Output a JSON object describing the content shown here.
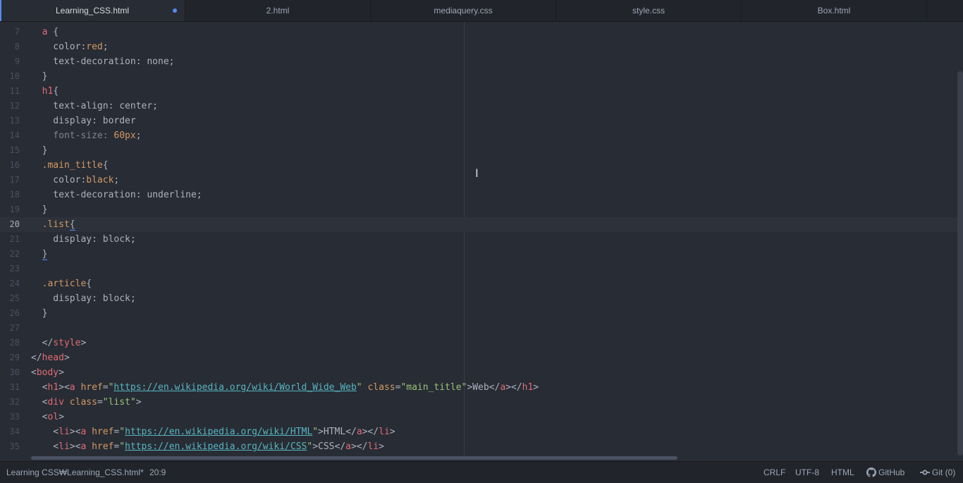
{
  "tabs": [
    {
      "label": "Learning_CSS.html",
      "modified": true
    },
    {
      "label": "2.html"
    },
    {
      "label": "mediaquery.css"
    },
    {
      "label": "style.css"
    },
    {
      "label": "Box.html"
    }
  ],
  "editor": {
    "lines": [
      {
        "n": "7",
        "segs": [
          [
            "t-punc",
            "  "
          ],
          [
            "t-tag",
            "a"
          ],
          [
            "t-punc",
            " {"
          ]
        ]
      },
      {
        "n": "8",
        "segs": [
          [
            "t-prop",
            "    color:"
          ],
          [
            "t-sel",
            "red"
          ],
          [
            "t-punc",
            ";"
          ]
        ]
      },
      {
        "n": "9",
        "segs": [
          [
            "t-prop",
            "    text-decoration: none;"
          ]
        ]
      },
      {
        "n": "10",
        "segs": [
          [
            "t-punc",
            "  }"
          ]
        ]
      },
      {
        "n": "11",
        "segs": [
          [
            "t-punc",
            "  "
          ],
          [
            "t-tag",
            "h1"
          ],
          [
            "t-punc",
            "{"
          ]
        ]
      },
      {
        "n": "12",
        "segs": [
          [
            "t-prop",
            "    text-align: center;"
          ]
        ]
      },
      {
        "n": "13",
        "segs": [
          [
            "t-prop",
            "    display: border"
          ]
        ]
      },
      {
        "n": "14",
        "segs": [
          [
            "t-dim",
            "    font-size: "
          ],
          [
            "t-num",
            "60px"
          ],
          [
            "t-punc",
            ";"
          ]
        ]
      },
      {
        "n": "15",
        "segs": [
          [
            "t-punc",
            "  }"
          ]
        ]
      },
      {
        "n": "16",
        "segs": [
          [
            "t-punc",
            "  "
          ],
          [
            "t-sel",
            ".main_title"
          ],
          [
            "t-punc",
            "{"
          ]
        ]
      },
      {
        "n": "17",
        "segs": [
          [
            "t-prop",
            "    color:"
          ],
          [
            "t-sel",
            "black"
          ],
          [
            "t-punc",
            ";"
          ]
        ]
      },
      {
        "n": "18",
        "segs": [
          [
            "t-prop",
            "    text-decoration: underline;"
          ]
        ]
      },
      {
        "n": "19",
        "segs": [
          [
            "t-punc",
            "  }"
          ]
        ]
      },
      {
        "n": "20",
        "cursor": true,
        "segs": [
          [
            "t-punc",
            "  "
          ],
          [
            "t-sel",
            ".list"
          ],
          [
            "t-bracket",
            "{"
          ]
        ]
      },
      {
        "n": "21",
        "segs": [
          [
            "t-prop",
            "    display: block;"
          ]
        ]
      },
      {
        "n": "22",
        "segs": [
          [
            "t-punc",
            "  "
          ],
          [
            "t-bracket",
            "}"
          ]
        ]
      },
      {
        "n": "23",
        "segs": []
      },
      {
        "n": "24",
        "segs": [
          [
            "t-punc",
            "  "
          ],
          [
            "t-sel",
            ".article"
          ],
          [
            "t-punc",
            "{"
          ]
        ]
      },
      {
        "n": "25",
        "segs": [
          [
            "t-prop",
            "    display: block;"
          ]
        ]
      },
      {
        "n": "26",
        "segs": [
          [
            "t-punc",
            "  }"
          ]
        ]
      },
      {
        "n": "27",
        "segs": []
      },
      {
        "n": "28",
        "segs": [
          [
            "t-punc",
            "  </"
          ],
          [
            "t-tag",
            "style"
          ],
          [
            "t-punc",
            ">"
          ]
        ]
      },
      {
        "n": "29",
        "segs": [
          [
            "t-punc",
            "</"
          ],
          [
            "t-tag",
            "head"
          ],
          [
            "t-punc",
            ">"
          ]
        ]
      },
      {
        "n": "30",
        "segs": [
          [
            "t-punc",
            "<"
          ],
          [
            "t-tag",
            "body"
          ],
          [
            "t-punc",
            ">"
          ]
        ]
      },
      {
        "n": "31",
        "segs": [
          [
            "t-punc",
            "  <"
          ],
          [
            "t-tag",
            "h1"
          ],
          [
            "t-punc",
            "><"
          ],
          [
            "t-tag",
            "a"
          ],
          [
            "t-attr",
            " href"
          ],
          [
            "t-punc",
            "="
          ],
          [
            "t-str",
            "\""
          ],
          [
            "t-url",
            "https://en.wikipedia.org/wiki/World_Wide_Web"
          ],
          [
            "t-str",
            "\""
          ],
          [
            "t-attr",
            " class"
          ],
          [
            "t-punc",
            "="
          ],
          [
            "t-str",
            "\"main_title\""
          ],
          [
            "t-punc",
            ">Web</"
          ],
          [
            "t-tag",
            "a"
          ],
          [
            "t-punc",
            "></"
          ],
          [
            "t-tag",
            "h1"
          ],
          [
            "t-punc",
            ">"
          ]
        ]
      },
      {
        "n": "32",
        "segs": [
          [
            "t-punc",
            "  <"
          ],
          [
            "t-tag",
            "div"
          ],
          [
            "t-attr",
            " class"
          ],
          [
            "t-punc",
            "="
          ],
          [
            "t-str",
            "\"list\""
          ],
          [
            "t-punc",
            ">"
          ]
        ]
      },
      {
        "n": "33",
        "segs": [
          [
            "t-punc",
            "  <"
          ],
          [
            "t-tag",
            "ol"
          ],
          [
            "t-punc",
            ">"
          ]
        ]
      },
      {
        "n": "34",
        "segs": [
          [
            "t-punc",
            "    <"
          ],
          [
            "t-tag",
            "li"
          ],
          [
            "t-punc",
            "><"
          ],
          [
            "t-tag",
            "a"
          ],
          [
            "t-attr",
            " href"
          ],
          [
            "t-punc",
            "="
          ],
          [
            "t-str",
            "\""
          ],
          [
            "t-url",
            "https://en.wikipedia.org/wiki/HTML"
          ],
          [
            "t-str",
            "\""
          ],
          [
            "t-punc",
            ">HTML</"
          ],
          [
            "t-tag",
            "a"
          ],
          [
            "t-punc",
            "></"
          ],
          [
            "t-tag",
            "li"
          ],
          [
            "t-punc",
            ">"
          ]
        ]
      },
      {
        "n": "35",
        "segs": [
          [
            "t-punc",
            "    <"
          ],
          [
            "t-tag",
            "li"
          ],
          [
            "t-punc",
            "><"
          ],
          [
            "t-tag",
            "a"
          ],
          [
            "t-attr",
            " href"
          ],
          [
            "t-punc",
            "="
          ],
          [
            "t-str",
            "\""
          ],
          [
            "t-url",
            "https://en.wikipedia.org/wiki/CSS"
          ],
          [
            "t-str",
            "\""
          ],
          [
            "t-punc",
            ">CSS</"
          ],
          [
            "t-tag",
            "a"
          ],
          [
            "t-punc",
            "></"
          ],
          [
            "t-tag",
            "li"
          ],
          [
            "t-punc",
            ">"
          ]
        ]
      }
    ]
  },
  "status": {
    "file_path": "Learning CSS₩Learning_CSS.html*",
    "cursor_pos": "20:9",
    "line_ending": "CRLF",
    "encoding": "UTF-8",
    "grammar": "HTML",
    "github_label": "GitHub",
    "git_label": "Git (0)"
  },
  "icons": {
    "github": "github-icon",
    "git": "git-commit-icon"
  },
  "colors": {
    "accent": "#568af2",
    "background": "#282c34",
    "panel": "#21252b"
  }
}
